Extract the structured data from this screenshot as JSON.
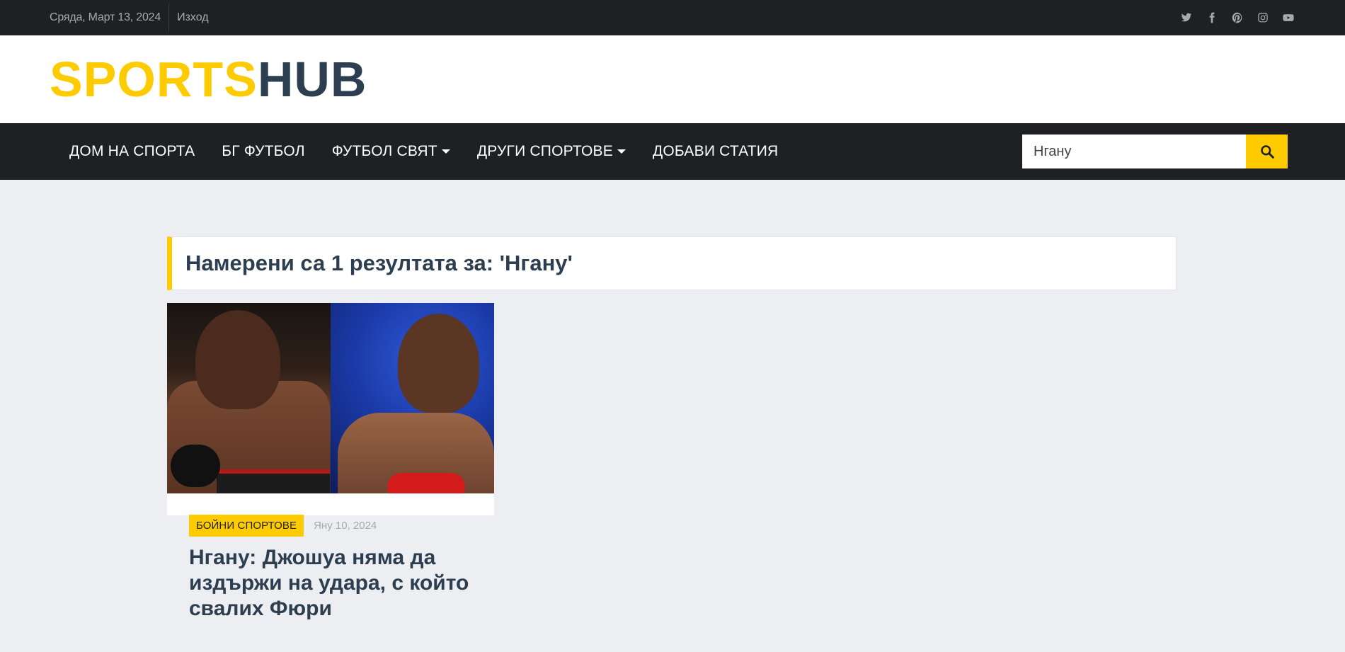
{
  "topbar": {
    "date": "Сряда, Март 13, 2024",
    "logout": "Изход",
    "social_icons": [
      "twitter-icon",
      "facebook-icon",
      "pinterest-icon",
      "instagram-icon",
      "youtube-icon"
    ]
  },
  "logo": {
    "part1": "SPORTS",
    "part2": "HUB",
    "colors": {
      "part1": "#fecb00",
      "part2": "#2c3e50"
    }
  },
  "nav": {
    "items": [
      {
        "label": "ДОМ НА СПОРТА",
        "dropdown": false
      },
      {
        "label": "БГ ФУТБОЛ",
        "dropdown": false
      },
      {
        "label": "ФУТБОЛ СВЯТ",
        "dropdown": true
      },
      {
        "label": "ДРУГИ СПОРТОВЕ",
        "dropdown": true
      },
      {
        "label": "ДОБАВИ СТАТИЯ",
        "dropdown": false
      }
    ],
    "search_value": "Нгану"
  },
  "results": {
    "heading": "Намерени са 1 резултата за: 'Нгану'"
  },
  "articles": [
    {
      "category": "БОЙНИ СПОРТОВЕ",
      "date": "Яну 10, 2024",
      "title": "Нгану: Джошуа няма да издържи на удара, с който свалих Фюри"
    }
  ],
  "colors": {
    "accent": "#fecb00",
    "dark": "#1f2024",
    "text": "#2c3e50",
    "background": "#edeef2"
  }
}
